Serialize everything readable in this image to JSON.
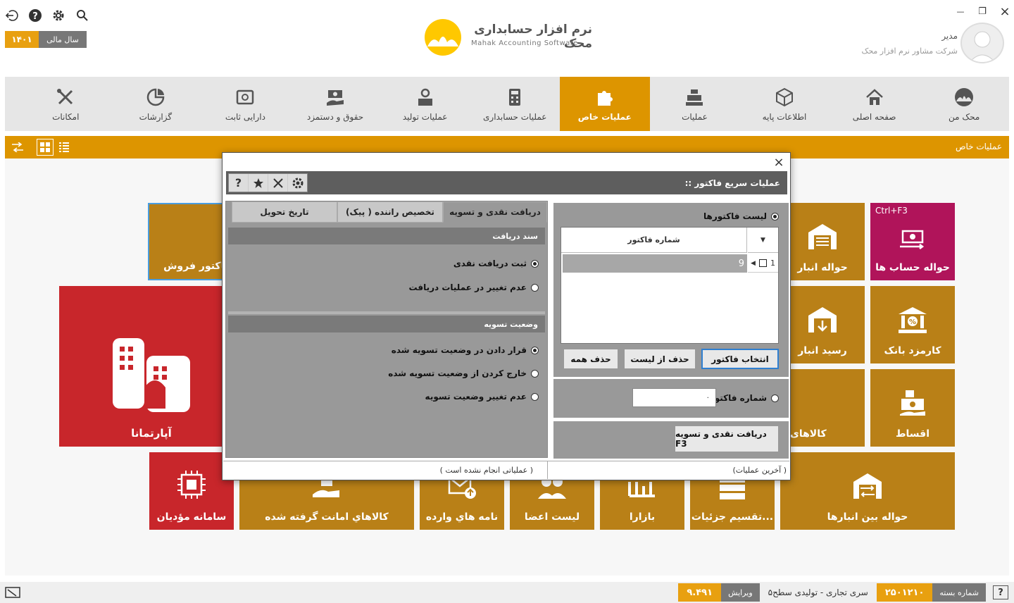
{
  "window": {
    "close_icon": "×",
    "restore_icon": "❐",
    "minimize_icon": "—"
  },
  "tools": {
    "search": "search-icon",
    "settings": "gear-icon",
    "help": "help-icon",
    "exit": "exit-icon"
  },
  "fiscal_year": {
    "label": "سال مالی",
    "value": "۱۴۰۱"
  },
  "logo": {
    "title": "نرم افزار حسابداری محک",
    "subtitle": "Mahak Accounting Software"
  },
  "user": {
    "name": "مدیر",
    "company": "شرکت مشاور نرم افزار محک"
  },
  "nav": [
    {
      "label": "محک من"
    },
    {
      "label": "صفحه اصلی"
    },
    {
      "label": "اطلاعات پایه"
    },
    {
      "label": "عملیات"
    },
    {
      "label": "عملیات خاص"
    },
    {
      "label": "عملیات حسابداری"
    },
    {
      "label": "عملیات تولید"
    },
    {
      "label": "حقوق و دستمزد"
    },
    {
      "label": "دارایی ثابت"
    },
    {
      "label": "گزارشات"
    },
    {
      "label": "امکانات"
    }
  ],
  "section_bar": {
    "title": "عملیات خاص"
  },
  "tiles": {
    "havaleh_hesab": {
      "label": "حواله حساب ها",
      "shortcut": "Ctrl+F3"
    },
    "havaleh_anbar": {
      "label": "حواله انبار"
    },
    "factor_forush": {
      "label": "فاکتور فروش"
    },
    "karmozd_bank": {
      "label": "کارمزد بانک"
    },
    "resid_anbar": {
      "label": "رسید انبار"
    },
    "apartmana": {
      "label": "آپارتمانا"
    },
    "aqsat": {
      "label": "اقساط"
    },
    "kalaha": {
      "label": "کالاهای"
    },
    "samaneh": {
      "label": "سامانه مؤدیان"
    },
    "amanat": {
      "label": "کالاهاي امانت گرفته شده"
    },
    "nameh": {
      "label": "نامه هاي وارده"
    },
    "aza": {
      "label": "لیست اعضا"
    },
    "bazara": {
      "label": "بازارا"
    },
    "taqsim": {
      "label": "تقسیم جزئیات..."
    },
    "beyn_anbar": {
      "label": "حواله بین انبارها"
    }
  },
  "dialog": {
    "title": ":: عملیات سریع فاکتور",
    "close": "×",
    "toolbar": {
      "settings": "gear-icon",
      "tools": "tools-icon",
      "star": "star-icon",
      "help": "?"
    },
    "invoice_list_label": "لیست فاکتورها",
    "grid_header": "شماره فاکتور",
    "grid_rows": [
      {
        "index": "1",
        "number": "9"
      }
    ],
    "buttons": {
      "select": "انتخاب فاکتور",
      "remove": "حذف از لیست",
      "remove_all": "حذف همه"
    },
    "invoice_number_label": "شماره فاکتور",
    "invoice_number_value": "۰",
    "action_button": "دریافت نقدی و تسویه F3",
    "tabs": [
      "دریافت نقدی و تسویه",
      "تخصیص راننده ( پیک)",
      "تاریخ تحویل"
    ],
    "receipt_header": "سند دریافت",
    "receipt_options": [
      "ثبت دریافت نقدی",
      "عدم تغییر در عملیات دریافت"
    ],
    "settle_header": "وضعیت تسویه",
    "settle_options": [
      "قرار دادن در وضعیت تسویه شده",
      "خارج کردن از وضعیت تسویه شده",
      "عدم تغییر وضعیت تسویه"
    ],
    "last_ops": "(آخرین عملیات )",
    "no_ops": "( عملیاتی انجام نشده است )"
  },
  "status": {
    "package_label": "شماره بسته",
    "package_value": "۲۵۰۱۲۱۰",
    "series": "سری تجاری - تولیدی سطح۵",
    "version_label": "ویرایش",
    "version_value": "۹.۴۹۱"
  },
  "colors": {
    "accent": "#DD9500",
    "tile": "#B98017",
    "magenta": "#B0145A",
    "red": "#C8262B"
  }
}
